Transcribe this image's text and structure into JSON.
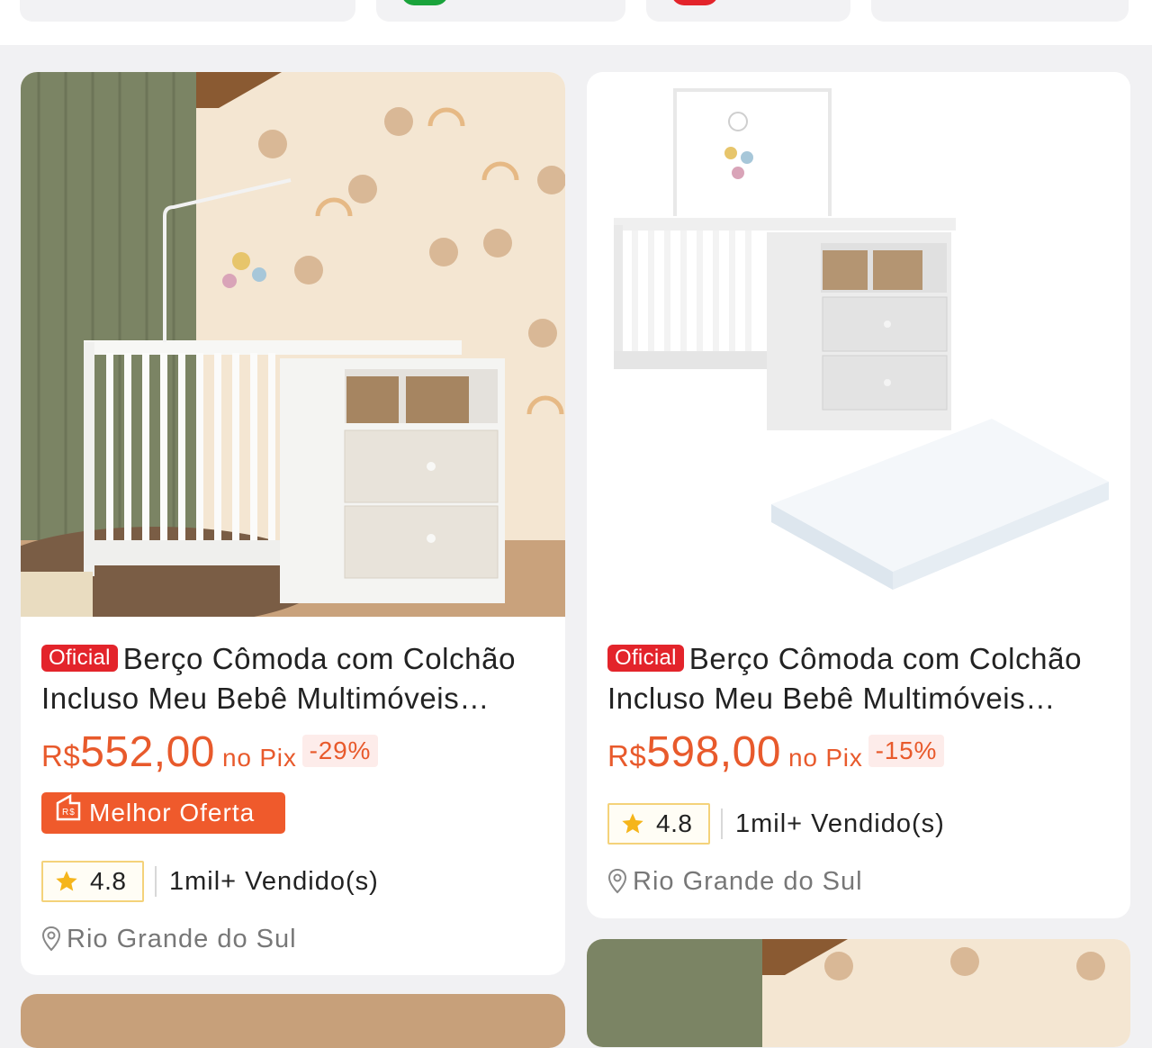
{
  "colors": {
    "accent_orange": "#e85a2c",
    "official_red": "#e3242b",
    "star": "#f5b51b"
  },
  "top_chips": [
    {
      "icon": "green-tag-icon"
    },
    {
      "icon": "red-tag-icon"
    }
  ],
  "products": [
    {
      "badge": "Oficial",
      "title": "Berço Cômoda com Colchão Incluso Meu Bebê Multimóveis Branco",
      "price_currency": "R$",
      "price_value": "552,00",
      "price_suffix": "no Pix",
      "discount": "-29%",
      "tag": "Melhor Oferta",
      "rating": "4.8",
      "sold": "1mil+ Vendido(s)",
      "location": "Rio Grande do Sul"
    },
    {
      "badge": "Oficial",
      "title": "Berço Cômoda com Colchão Incluso Meu Bebê Multimóveis Branco",
      "price_currency": "R$",
      "price_value": "598,00",
      "price_suffix": "no Pix",
      "discount": "-15%",
      "rating": "4.8",
      "sold": "1mil+ Vendido(s)",
      "location": "Rio Grande do Sul"
    }
  ]
}
